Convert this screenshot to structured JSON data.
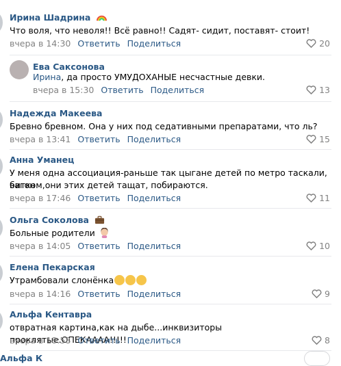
{
  "comments": [
    {
      "name": "Ирина Шадрина",
      "text": "Что воля, что неволя!! Всё равно!! Садят- сидит, поставят- стоит!",
      "time": "вчера в 14:30",
      "reply": "Ответить",
      "share": "Поделиться",
      "likes": "20",
      "badge": "rainbow-icon"
    },
    {
      "name": "Ева Саксонова",
      "reply_to": "Ирина",
      "text": ", да просто УМУДОХАНЫЕ несчастные девки.",
      "time": "вчера в 15:30",
      "reply": "Ответить",
      "share": "Поделиться",
      "likes": "13"
    },
    {
      "name": "Надежда Макеева",
      "text": "Бревно бревном. Она у них под седативными препаратами, что ль?",
      "time": "вчера в 13:41",
      "reply": "Ответить",
      "share": "Поделиться",
      "likes": "15"
    },
    {
      "name": "Анна Уманец",
      "text1": "У меня одна ассоциация-раньше так цыгане детей по метро таскали, вагон",
      "text2": "битком,они этих детей тащат, побираются.",
      "time": "вчера в 17:46",
      "reply": "Ответить",
      "share": "Поделиться",
      "likes": "11"
    },
    {
      "name": "Ольга Соколова",
      "text": "Больные родители",
      "time": "вчера в 14:05",
      "reply": "Ответить",
      "share": "Поделиться",
      "likes": "10",
      "badge": "briefcase-icon"
    },
    {
      "name": "Елена Пекарская",
      "text": "Утрамбовали слонёнка",
      "time": "вчера в 14:16",
      "reply": "Ответить",
      "share": "Поделиться",
      "likes": "9"
    },
    {
      "name": "Альфа Кентавра",
      "text": "отвратная картина,как на дыбе...инквизиторы проклятые.ОПЕКАААА!!!!!",
      "time": "вчера в 18:58",
      "reply": "Ответить",
      "share": "Поделиться",
      "likes": "8"
    }
  ],
  "overflow_name": "Альфа К",
  "colors": {
    "link": "#2a5885",
    "meta": "#828282",
    "separator": "#e7e8ec"
  }
}
